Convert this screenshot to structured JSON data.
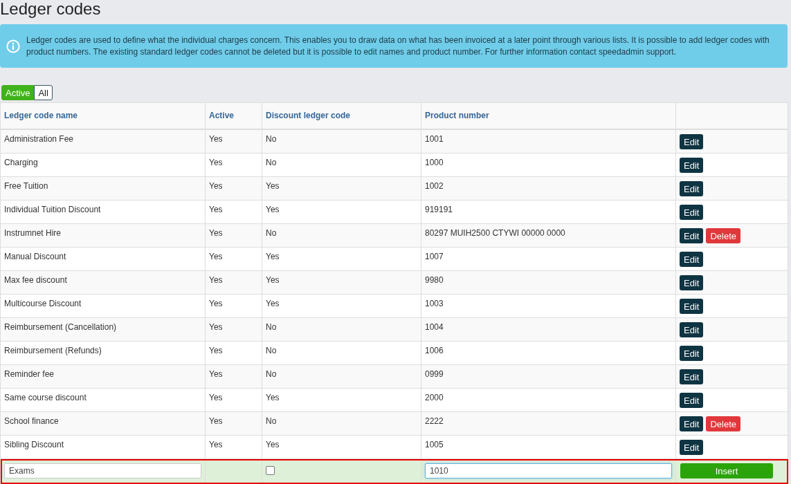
{
  "page": {
    "title": "Ledger codes"
  },
  "info": {
    "text": "Ledger codes are used to define what the individual charges concern. This enables you to draw data on what has been invoiced at a later point through various lists. It is possible to add ledger codes with product numbers. The existing standard ledger codes cannot be deleted but it is possible to edit names and product number. For further information contact speedadmin support."
  },
  "filter": [
    {
      "label": "Active",
      "selected": true
    },
    {
      "label": "All",
      "selected": false
    }
  ],
  "table": {
    "columns": [
      "Ledger code name",
      "Active",
      "Discount ledger code",
      "Product number"
    ],
    "rows": [
      {
        "cells": [
          "Administration Fee",
          "Yes",
          "No",
          "1001"
        ],
        "actions": [
          {
            "kind": "edit",
            "label": "Edit"
          }
        ]
      },
      {
        "cells": [
          "Charging",
          "Yes",
          "No",
          "1000"
        ],
        "actions": [
          {
            "kind": "edit",
            "label": "Edit"
          }
        ]
      },
      {
        "cells": [
          "Free Tuition",
          "Yes",
          "Yes",
          "1002"
        ],
        "actions": [
          {
            "kind": "edit",
            "label": "Edit"
          }
        ]
      },
      {
        "cells": [
          "Individual Tuition Discount",
          "Yes",
          "Yes",
          "919191"
        ],
        "actions": [
          {
            "kind": "edit",
            "label": "Edit"
          }
        ]
      },
      {
        "cells": [
          "Instrumnet Hire",
          "Yes",
          "No",
          "80297 MUIH2500 CTYWI 00000 0000"
        ],
        "actions": [
          {
            "kind": "edit",
            "label": "Edit"
          },
          {
            "kind": "delete",
            "label": "Delete"
          }
        ]
      },
      {
        "cells": [
          "Manual Discount",
          "Yes",
          "Yes",
          "1007"
        ],
        "actions": [
          {
            "kind": "edit",
            "label": "Edit"
          }
        ]
      },
      {
        "cells": [
          "Max fee discount",
          "Yes",
          "Yes",
          "9980"
        ],
        "actions": [
          {
            "kind": "edit",
            "label": "Edit"
          }
        ]
      },
      {
        "cells": [
          "Multicourse Discount",
          "Yes",
          "Yes",
          "1003"
        ],
        "actions": [
          {
            "kind": "edit",
            "label": "Edit"
          }
        ]
      },
      {
        "cells": [
          "Reimbursement (Cancellation)",
          "Yes",
          "No",
          "1004"
        ],
        "actions": [
          {
            "kind": "edit",
            "label": "Edit"
          }
        ]
      },
      {
        "cells": [
          "Reimbursement (Refunds)",
          "Yes",
          "No",
          "1006"
        ],
        "actions": [
          {
            "kind": "edit",
            "label": "Edit"
          }
        ]
      },
      {
        "cells": [
          "Reminder fee",
          "Yes",
          "No",
          "0999"
        ],
        "actions": [
          {
            "kind": "edit",
            "label": "Edit"
          }
        ]
      },
      {
        "cells": [
          "Same course discount",
          "Yes",
          "Yes",
          "2000"
        ],
        "actions": [
          {
            "kind": "edit",
            "label": "Edit"
          }
        ]
      },
      {
        "cells": [
          "School finance",
          "Yes",
          "No",
          "2222"
        ],
        "actions": [
          {
            "kind": "edit",
            "label": "Edit"
          },
          {
            "kind": "delete",
            "label": "Delete"
          }
        ]
      },
      {
        "cells": [
          "Sibling Discount",
          "Yes",
          "Yes",
          "1005"
        ],
        "actions": [
          {
            "kind": "edit",
            "label": "Edit"
          }
        ]
      }
    ],
    "new_row": {
      "highlighted": true,
      "name_field": {
        "value": "Exams",
        "focused": false
      },
      "discount_checkbox": {
        "checked": false
      },
      "product_field": {
        "value": "1010",
        "focused": true
      },
      "button": "Insert"
    }
  }
}
